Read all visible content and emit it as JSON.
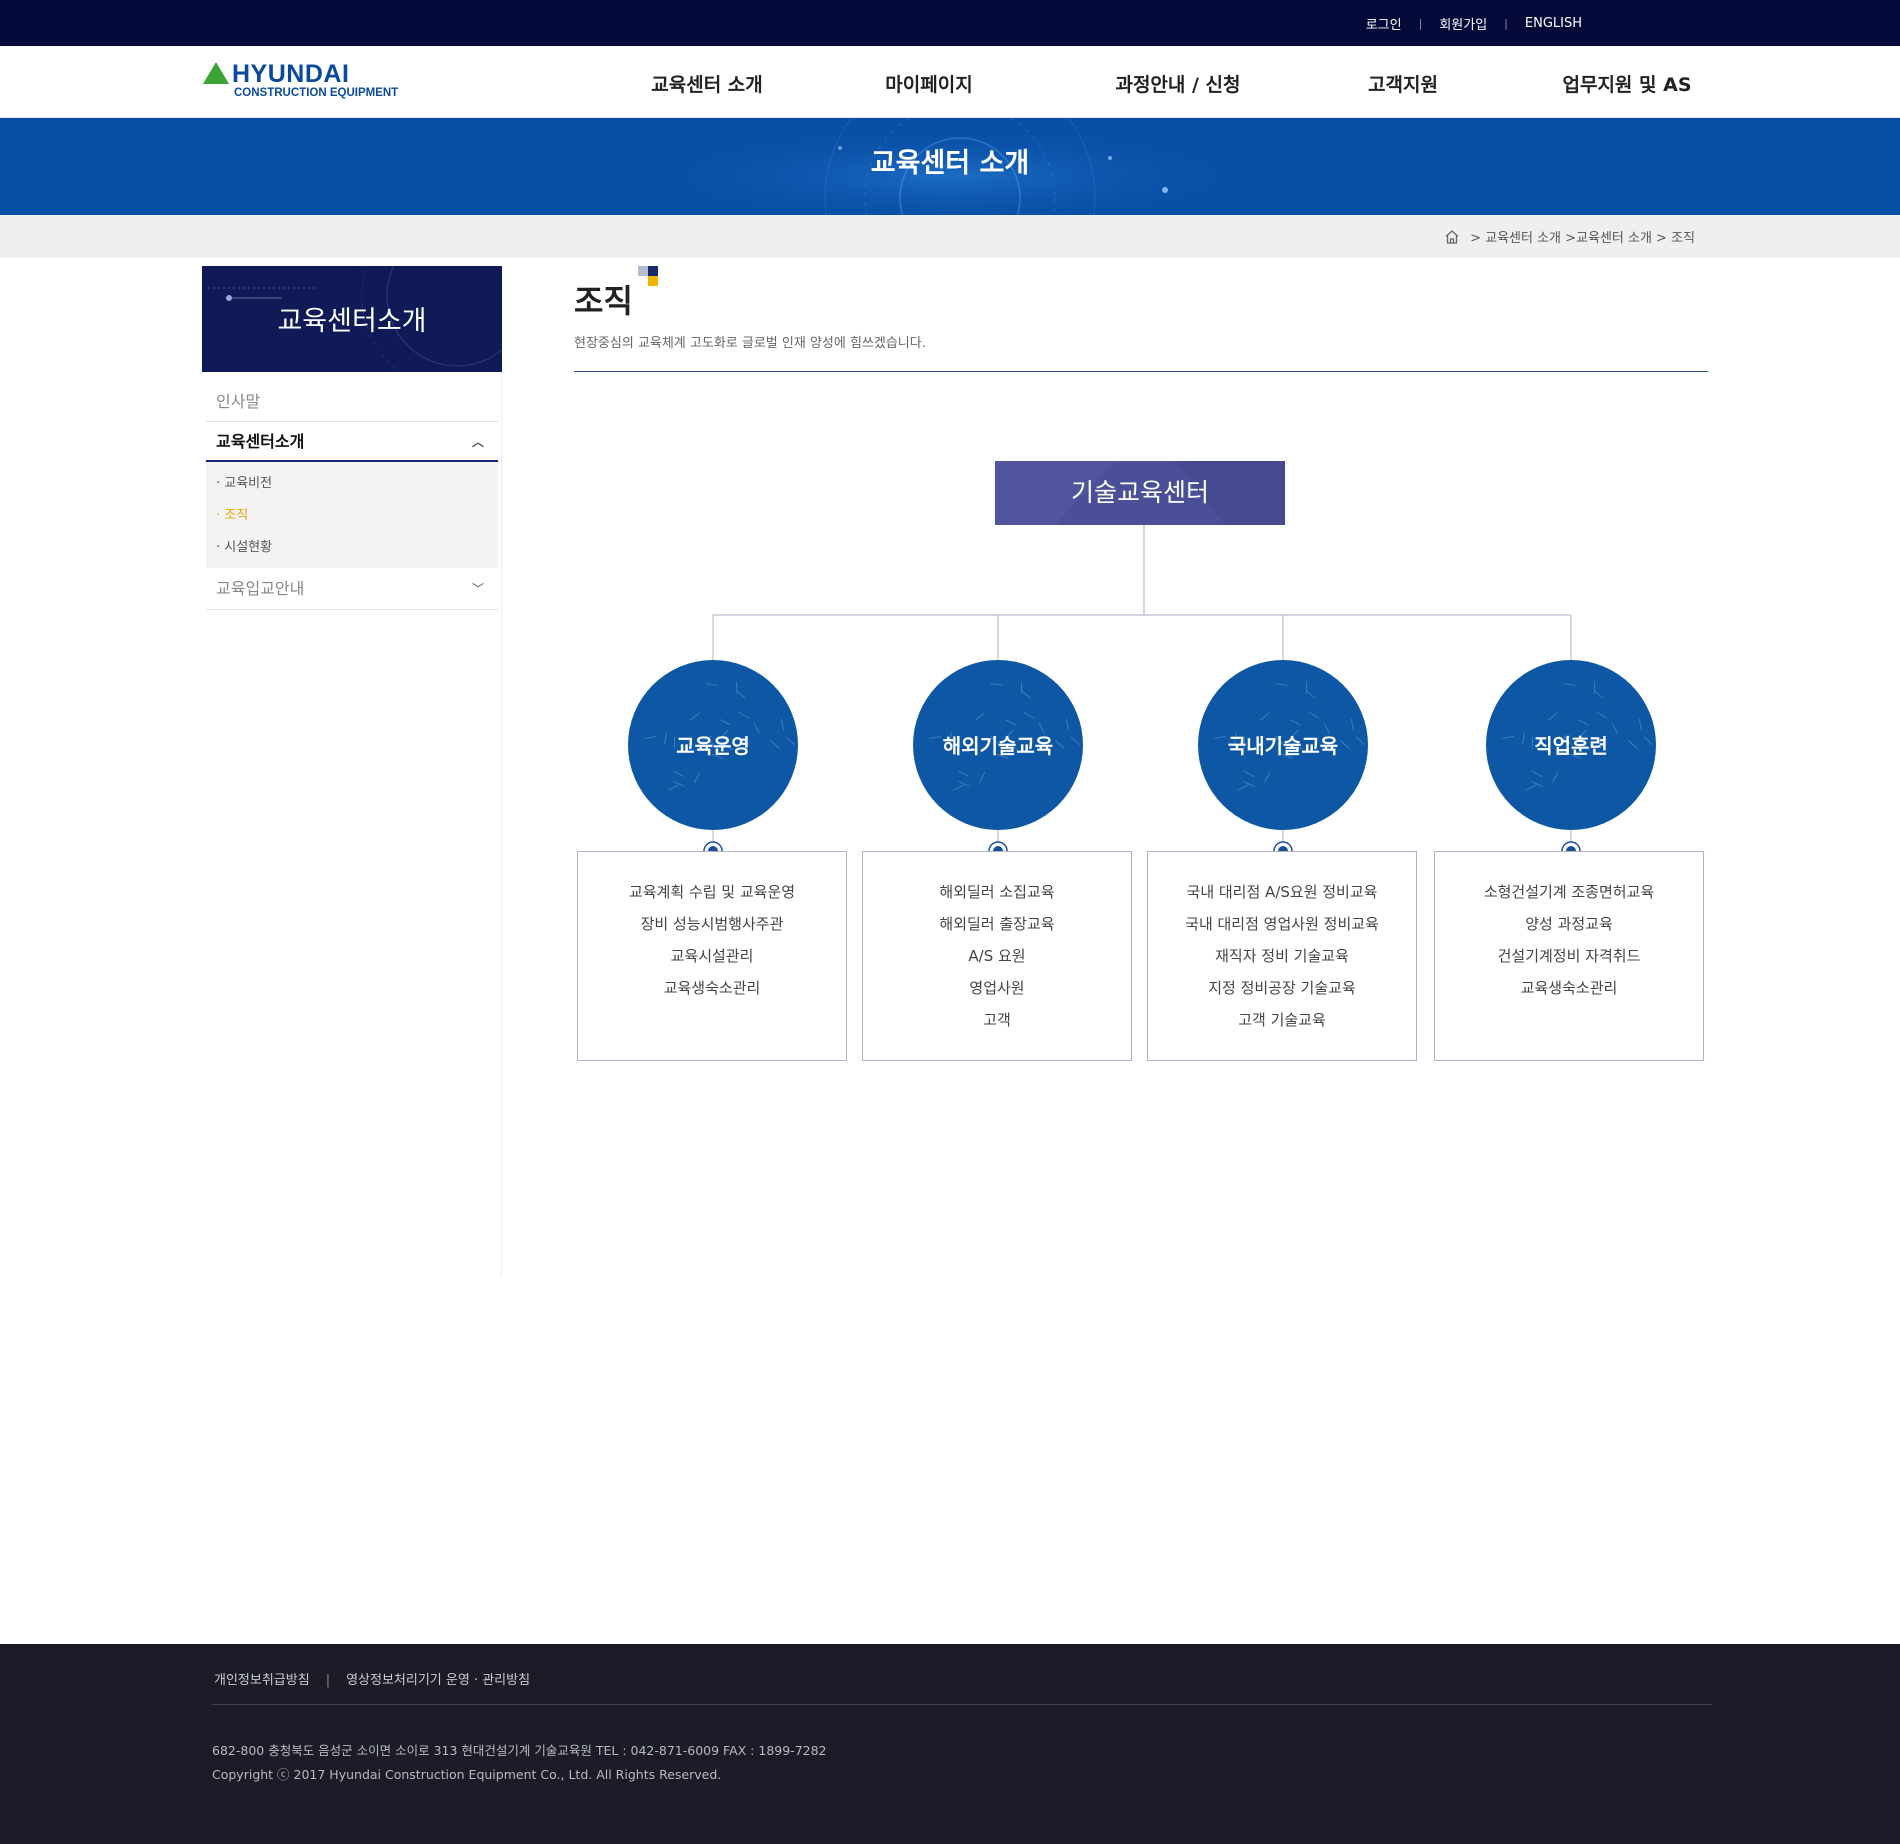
{
  "util": {
    "login": "로그인",
    "signup": "회원가입",
    "english": "ENGLISH"
  },
  "logo": {
    "main": "HYUNDAI",
    "sub": "CONSTRUCTION EQUIPMENT"
  },
  "gnb": [
    "교육센터 소개",
    "마이페이지",
    "과정안내 / 신청",
    "고객지원",
    "업무지원 및 AS"
  ],
  "banner": {
    "title": "교육센터 소개"
  },
  "breadcrumb": {
    "path": "> 교육센터 소개 >교육센터 소개 > 조직"
  },
  "sidebar": {
    "title": "교육센터소개",
    "items": [
      {
        "label": "인사말"
      },
      {
        "label": "교육센터소개"
      },
      {
        "label": "교육입교안내"
      }
    ],
    "sub_items": [
      "· 교육비전",
      "· 조직",
      "· 시설현황"
    ]
  },
  "content": {
    "title": "조직",
    "desc": "현장중심의 교육체계 고도화로 글로벌 인재 양성에 힘쓰겠습니다."
  },
  "org": {
    "top": "기술교육센터",
    "units": [
      {
        "name": "교육운영",
        "duties": [
          "교육계획 수립 및 교육운영",
          "장비 성능시범행사주관",
          "교육시설관리",
          "교육생숙소관리"
        ]
      },
      {
        "name": "해외기술교육",
        "duties": [
          "해외딜러 소집교육",
          "해외딜러 출장교육",
          "A/S 요원",
          "영업사원",
          "고객"
        ]
      },
      {
        "name": "국내기술교육",
        "duties": [
          "국내 대리점 A/S요원 정비교육",
          "국내 대리점 영업사원 정비교육",
          "재직자 정비 기술교육",
          "지정 정비공장 기술교육",
          "고객 기술교육"
        ]
      },
      {
        "name": "직업훈련",
        "duties": [
          "소형건설기계 조종면허교육",
          "양성 과정교육",
          "건설기계정비 자격취드",
          "교육생숙소관리"
        ]
      }
    ]
  },
  "footer": {
    "privacy": "개인정보취급방침",
    "cctv": "영상정보처리기기 운영 · 관리방침",
    "address": "682-800  충청북도 음성군 소이면 소이로 313 현대건설기계 기술교육원 TEL : 042-871-6009 FAX : 1899-7282",
    "copyright": "Copyright ⓒ 2017 Hyundai Construction Equipment Co., Ltd. All Rights Reserved."
  },
  "colors": {
    "top_bar": "#050a3a",
    "banner": "#0a4fa6",
    "circle": "#0d57a5",
    "org_top": "#4a4f98",
    "active_sub": "#e8a400",
    "footer": "#1b1c28"
  }
}
